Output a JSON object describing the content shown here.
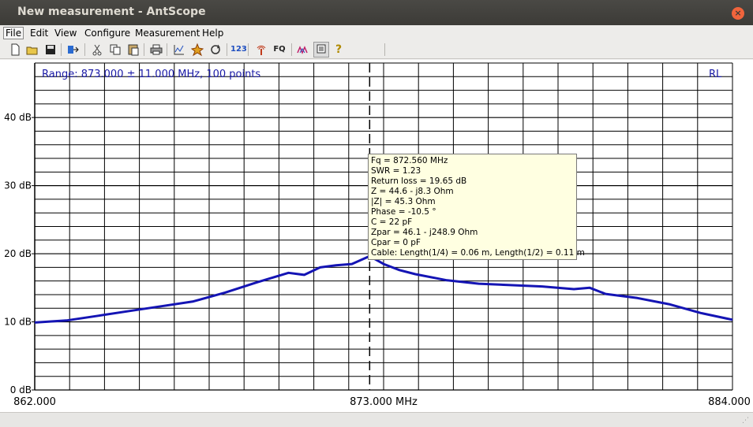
{
  "window": {
    "title": "New measurement - AntScope",
    "close_glyph": "×"
  },
  "menu": {
    "items": [
      {
        "label": "File",
        "active": true
      },
      {
        "label": "Edit"
      },
      {
        "label": "View"
      },
      {
        "label": "Configure"
      },
      {
        "label": "Measurement"
      },
      {
        "label": "Help"
      }
    ]
  },
  "toolbar": {
    "icons": [
      "new-icon",
      "open-icon",
      "save-icon",
      "export-icon",
      "cut-icon",
      "copy-icon",
      "paste-icon",
      "print-icon",
      "chart-icon",
      "sweep-icon",
      "refresh-icon",
      "numeric-icon",
      "antenna-icon",
      "frequency-icon",
      "markers-icon",
      "notes-icon",
      "help-icon"
    ],
    "numeric_label": "123",
    "fq_label": "FQ",
    "help_label": "?"
  },
  "plot": {
    "range_text": "Range: 873.000 ± 11.000 MHz, 100 points",
    "mode_label": "RL",
    "y_ticks": [
      "0 dB",
      "10 dB",
      "20 dB",
      "30 dB",
      "40 dB"
    ],
    "x_ticks": [
      "862.000",
      "873.000 MHz",
      "884.000"
    ],
    "colors": {
      "trace": "#1414b4",
      "grid": "#000000",
      "range_text": "#1a1aa6"
    }
  },
  "chart_data": {
    "type": "line",
    "xlabel": "",
    "ylabel": "",
    "x_range_mhz": [
      862.0,
      884.0
    ],
    "ylim": [
      0,
      48
    ],
    "grid": true,
    "marker_x": 872.56,
    "series": [
      {
        "name": "RL",
        "x": [
          862.0,
          863.0,
          864.0,
          865.0,
          866.0,
          867.0,
          868.0,
          869.0,
          870.0,
          870.5,
          871.0,
          871.5,
          872.0,
          872.56,
          873.0,
          873.5,
          874.0,
          875.0,
          876.0,
          877.0,
          878.0,
          879.0,
          879.5,
          880.0,
          881.0,
          882.0,
          883.0,
          884.0
        ],
        "values": [
          9.9,
          10.2,
          10.9,
          11.6,
          12.3,
          13.0,
          14.3,
          15.8,
          17.2,
          16.9,
          18.0,
          18.3,
          18.5,
          19.65,
          18.5,
          17.6,
          17.0,
          16.1,
          15.6,
          15.4,
          15.2,
          14.8,
          15.0,
          14.1,
          13.5,
          12.6,
          11.3,
          10.3
        ]
      }
    ]
  },
  "tooltip": {
    "lines": [
      "Fq = 872.560 MHz",
      "SWR = 1.23",
      "Return loss = 19.65 dB",
      "Z = 44.6 - j8.3 Ohm",
      "|Z| = 45.3 Ohm",
      "Phase = -10.5 °",
      "C = 22 pF",
      "Zpar = 46.1 - j248.9 Ohm",
      "Cpar = 0 pF",
      "Cable: Length(1/4) = 0.06 m, Length(1/2) = 0.11 m"
    ]
  }
}
